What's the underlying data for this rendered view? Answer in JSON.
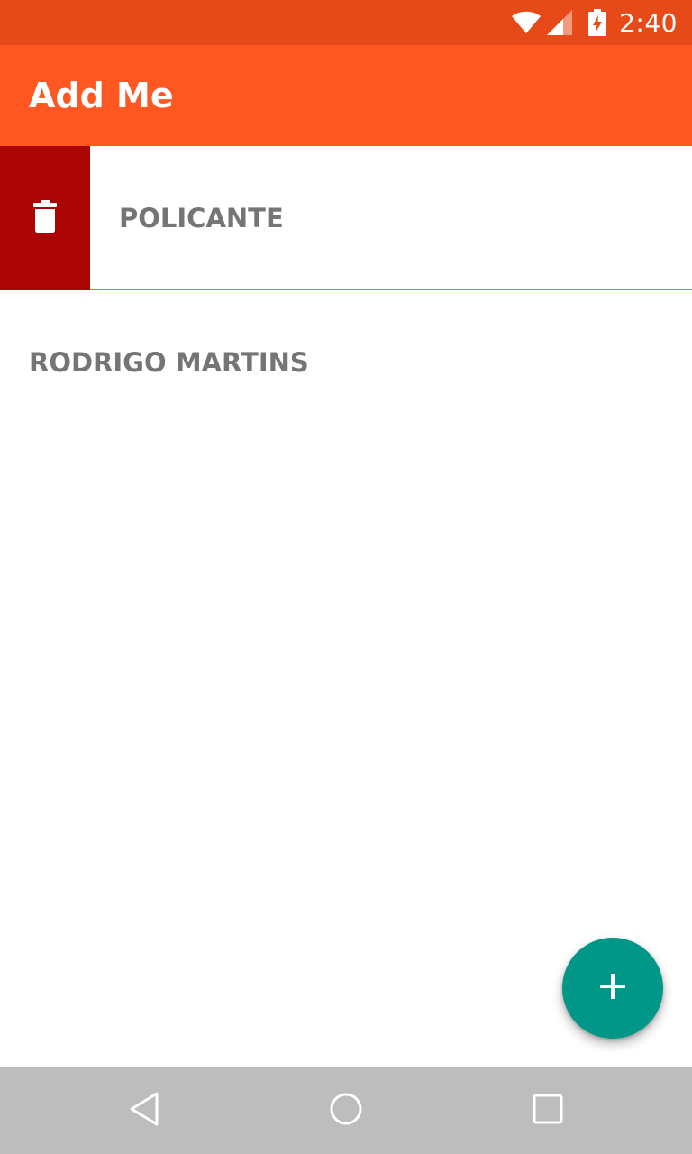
{
  "status_bar": {
    "time": "2:40",
    "icons": [
      "wifi-icon",
      "signal-icon",
      "battery-charging-icon"
    ]
  },
  "app_bar": {
    "title": "Add Me"
  },
  "list": {
    "items": [
      {
        "label": "POLICANTE",
        "swipe_action": "delete",
        "swipe_icon": "trash-icon"
      },
      {
        "label": "RODRIGO MARTINS"
      }
    ]
  },
  "fab": {
    "icon": "plus-icon"
  },
  "nav_bar": {
    "buttons": [
      "back-icon",
      "home-icon",
      "recents-icon"
    ]
  },
  "colors": {
    "status_bar": "#E64A19",
    "primary": "#FF5722",
    "delete_bg": "#AA0404",
    "fab": "#009688",
    "text_secondary": "#757575",
    "nav_bar": "#BDBDBD"
  }
}
